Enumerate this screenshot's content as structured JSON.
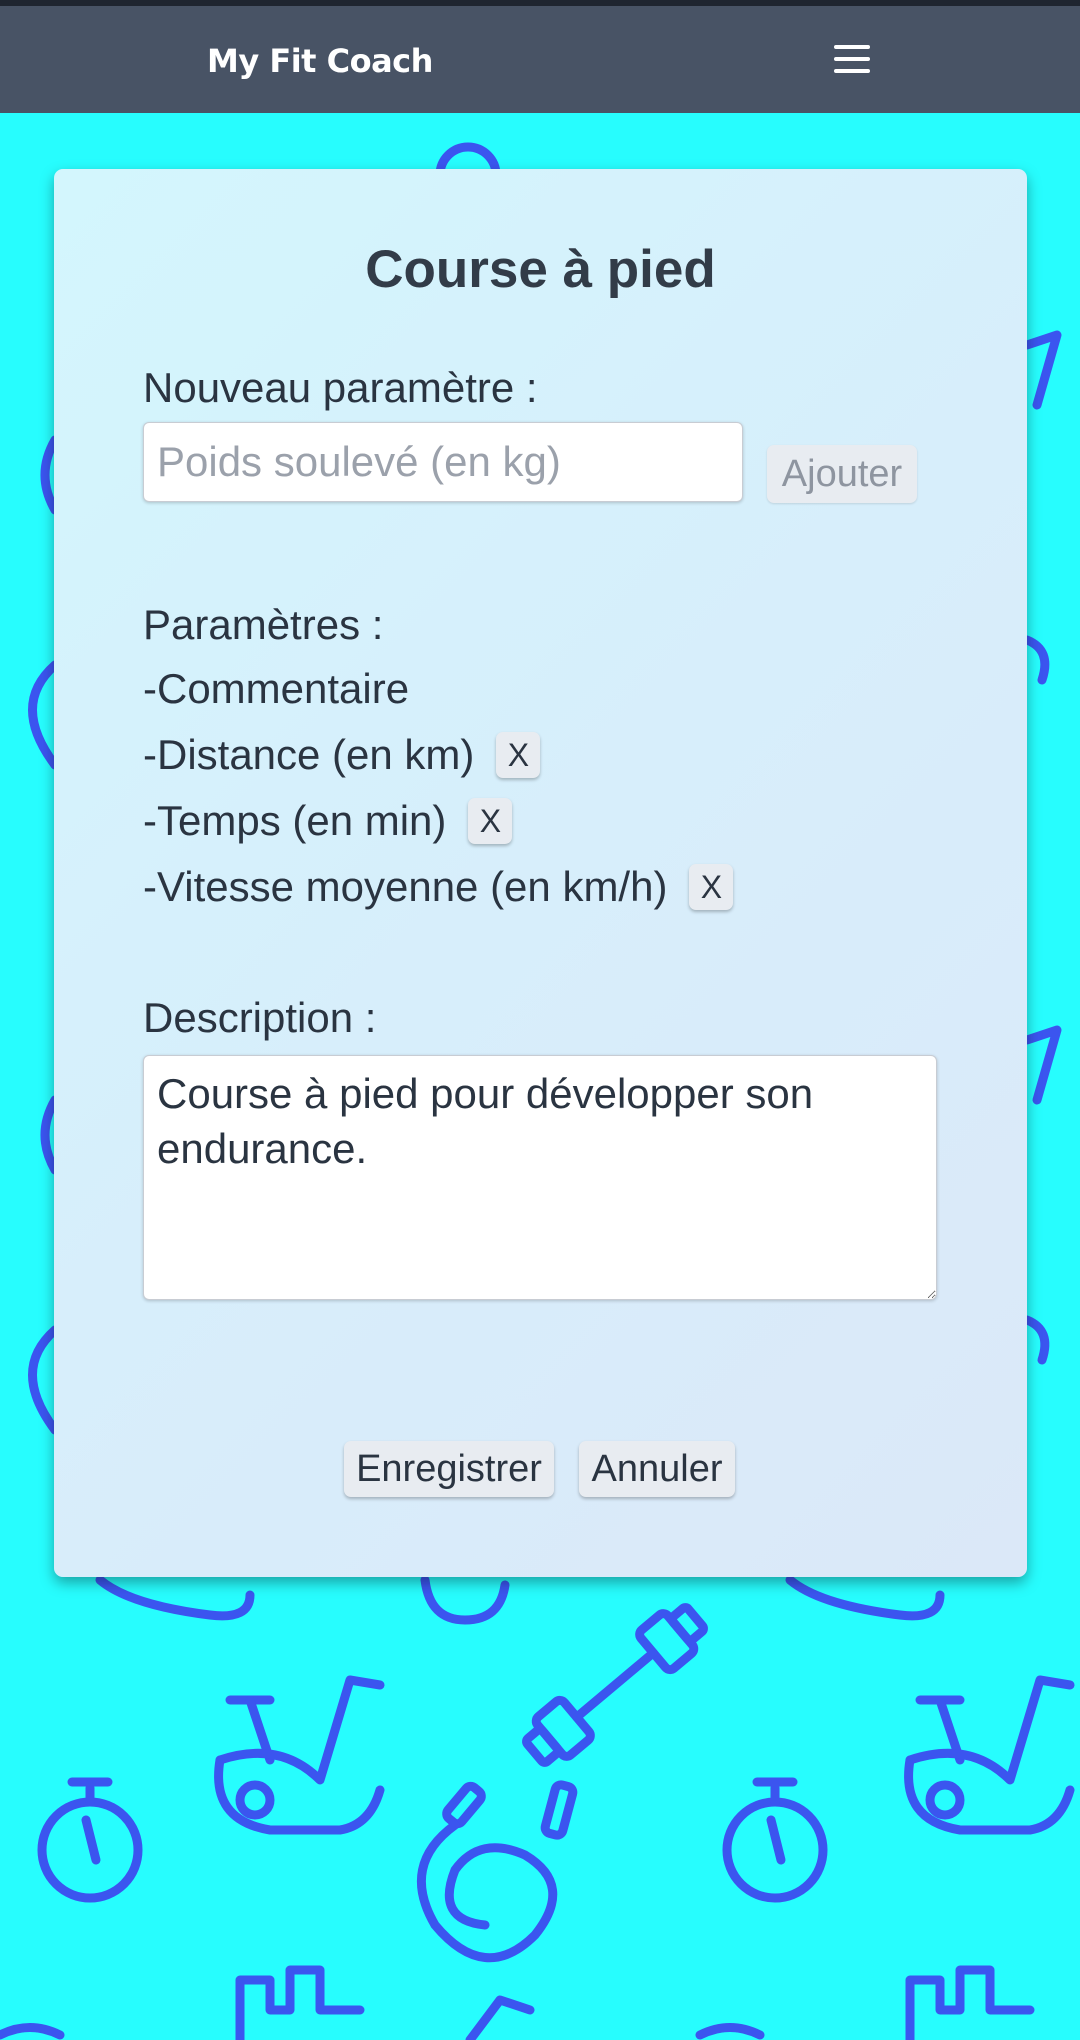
{
  "navbar": {
    "brand": "My Fit Coach",
    "menu_icon": "hamburger-menu-icon"
  },
  "background": {
    "color": "#27fdfe",
    "icon_color": "#3b55ef",
    "icons": [
      "kettlebell-icon",
      "exercise-bike-icon",
      "stopwatch-icon",
      "dumbbell-icon",
      "jump-rope-icon",
      "weight-bench-icon"
    ]
  },
  "card": {
    "title": "Course à pied",
    "new_param": {
      "label": "Nouveau paramètre :",
      "placeholder": "Poids soulevé (en kg)",
      "value": "",
      "add_label": "Ajouter"
    },
    "params": {
      "heading": "Paramètres :",
      "items": [
        {
          "label": "-Commentaire",
          "removable": false
        },
        {
          "label": "-Distance (en km)",
          "removable": true,
          "remove_label": "X"
        },
        {
          "label": "-Temps (en min)",
          "removable": true,
          "remove_label": "X"
        },
        {
          "label": "-Vitesse moyenne (en km/h)",
          "removable": true,
          "remove_label": "X"
        }
      ]
    },
    "description": {
      "label": "Description :",
      "value": "Course à pied pour développer son endurance."
    },
    "actions": {
      "save_label": "Enregistrer",
      "cancel_label": "Annuler"
    }
  },
  "colors": {
    "navbar": "#485365",
    "card_text": "#2a3441",
    "title_text": "#323c48"
  }
}
